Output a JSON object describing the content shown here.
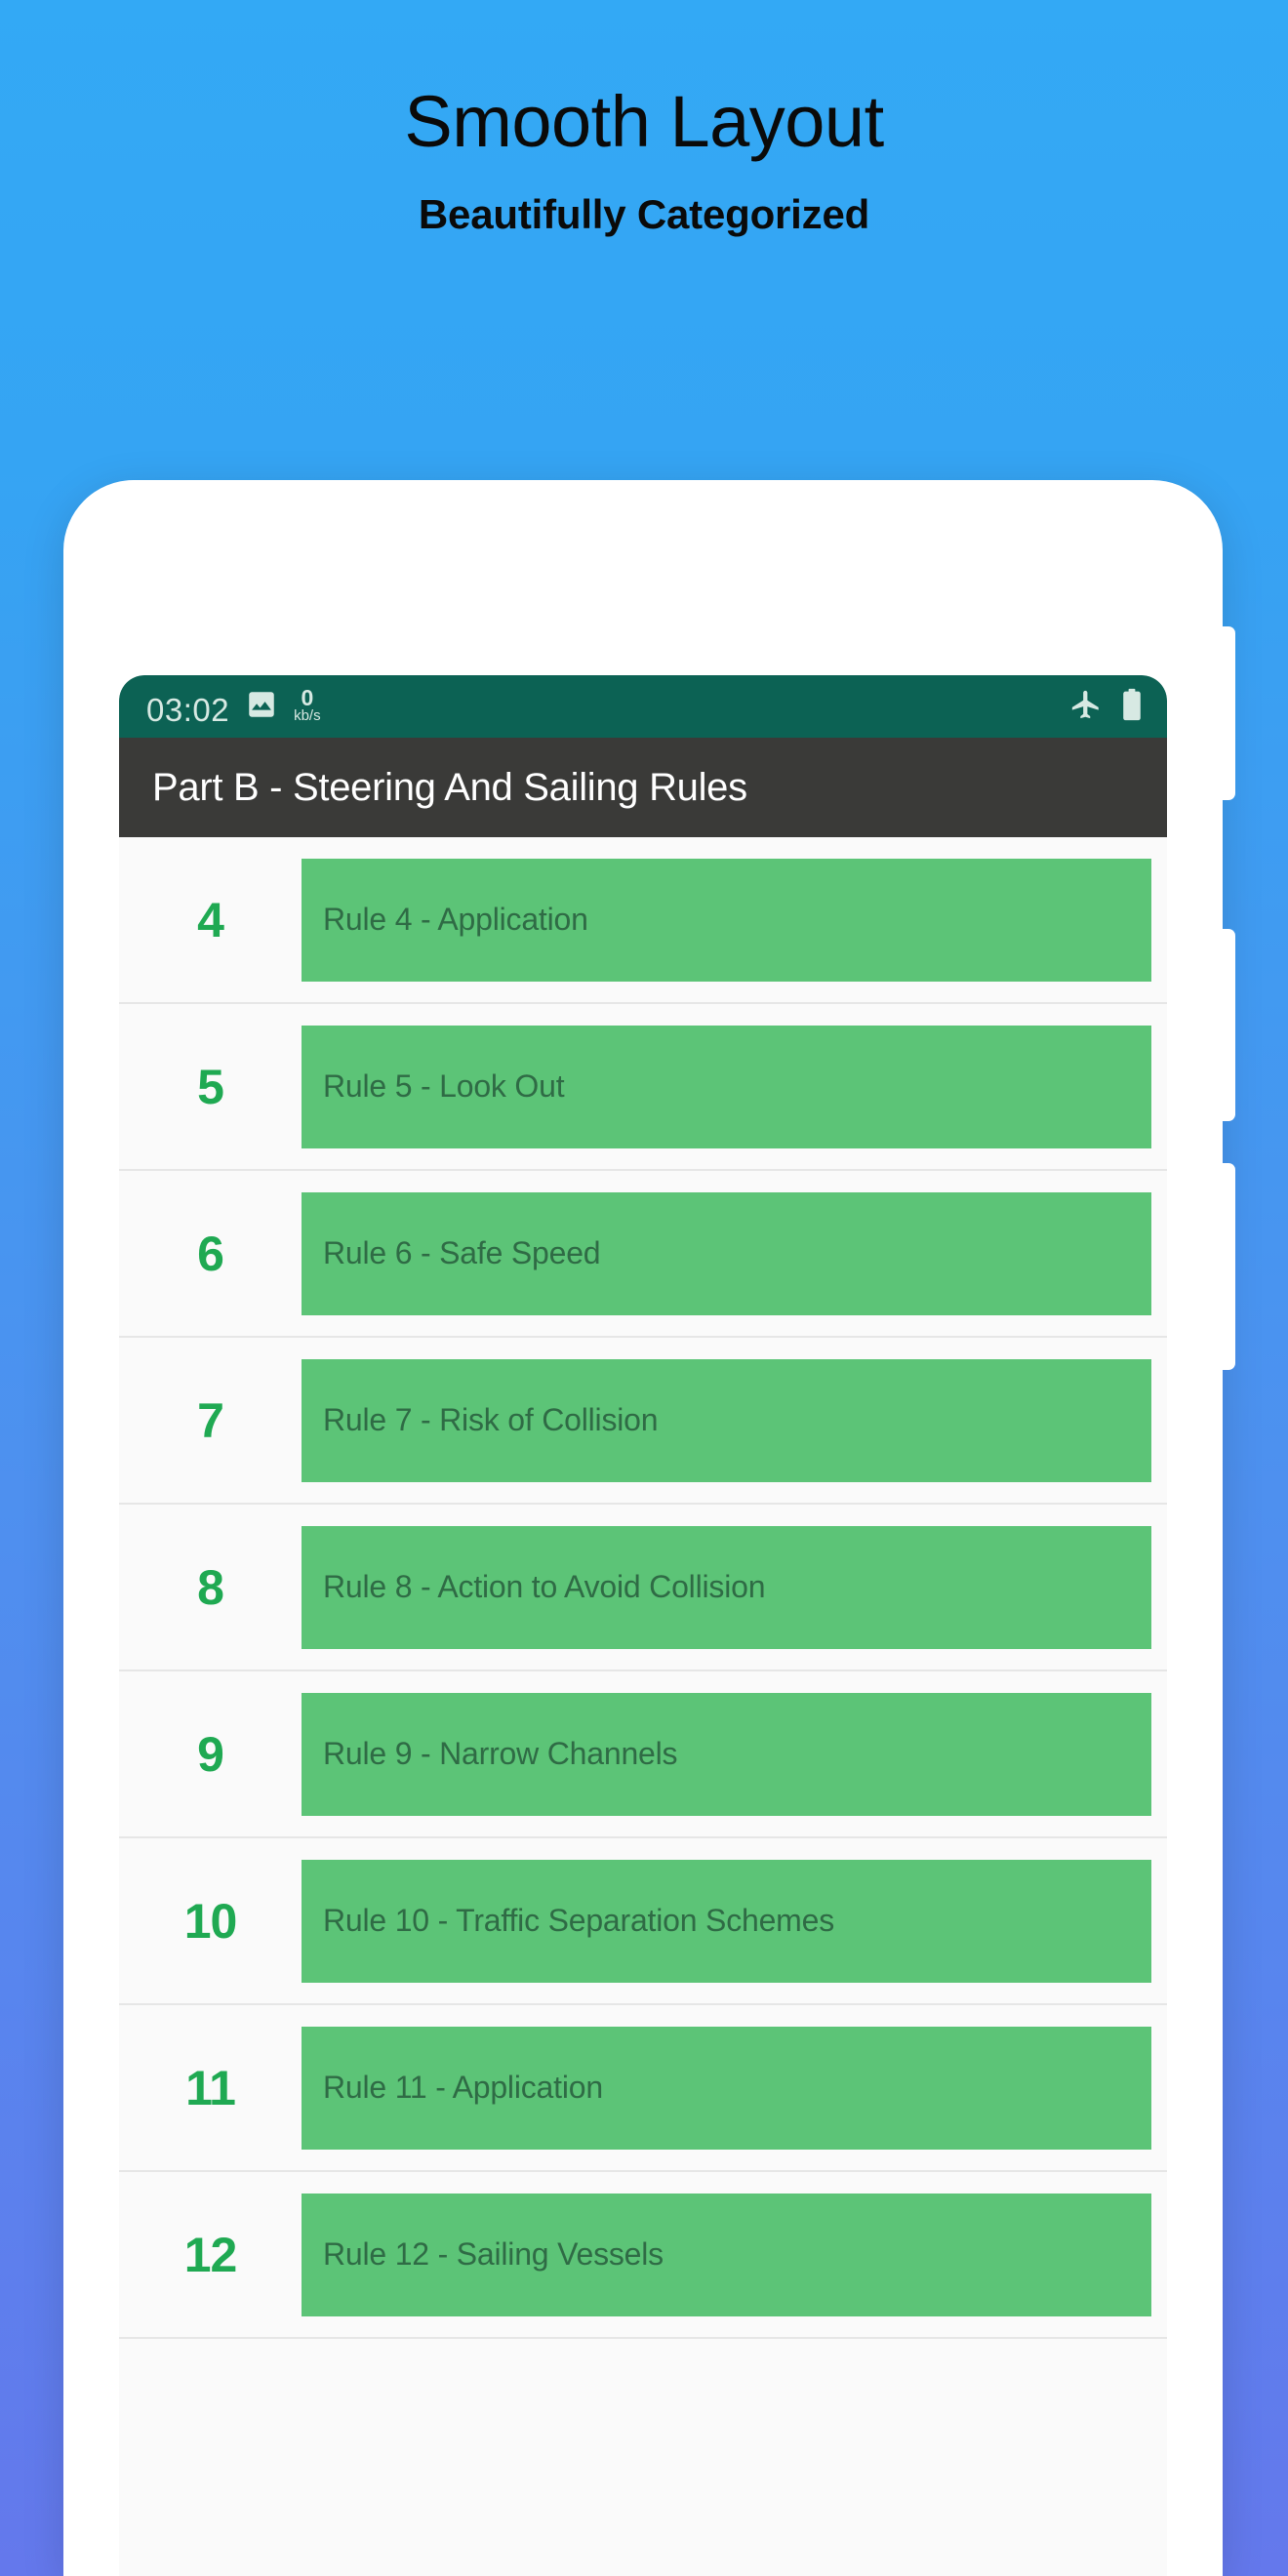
{
  "promo": {
    "title": "Smooth Layout",
    "subtitle": "Beautifully Categorized"
  },
  "colors": {
    "bg_top": "#33a9f5",
    "bg_bottom": "#6478ec",
    "statusbar": "#0c6254",
    "appbar": "#3a3a38",
    "chip": "#5cc477",
    "chip_text": "#2f6b45",
    "number": "#1fa952"
  },
  "phone": {
    "statusbar": {
      "time": "03:02",
      "image_icon": "image-icon",
      "network_rate_value": "0",
      "network_rate_unit": "kb/s",
      "airplane_icon": "airplane-mode-icon",
      "battery_icon": "battery-icon"
    },
    "appbar": {
      "title": "Part B - Steering And Sailing Rules"
    },
    "list": [
      {
        "number": "4",
        "label": "Rule 4 - Application"
      },
      {
        "number": "5",
        "label": "Rule 5 - Look Out"
      },
      {
        "number": "6",
        "label": "Rule 6 - Safe Speed"
      },
      {
        "number": "7",
        "label": "Rule 7 - Risk of Collision"
      },
      {
        "number": "8",
        "label": "Rule 8 - Action to Avoid Collision"
      },
      {
        "number": "9",
        "label": "Rule 9 - Narrow Channels"
      },
      {
        "number": "10",
        "label": "Rule 10 - Traffic Separation Schemes"
      },
      {
        "number": "11",
        "label": "Rule 11 - Application"
      },
      {
        "number": "12",
        "label": "Rule 12 - Sailing Vessels"
      }
    ]
  }
}
